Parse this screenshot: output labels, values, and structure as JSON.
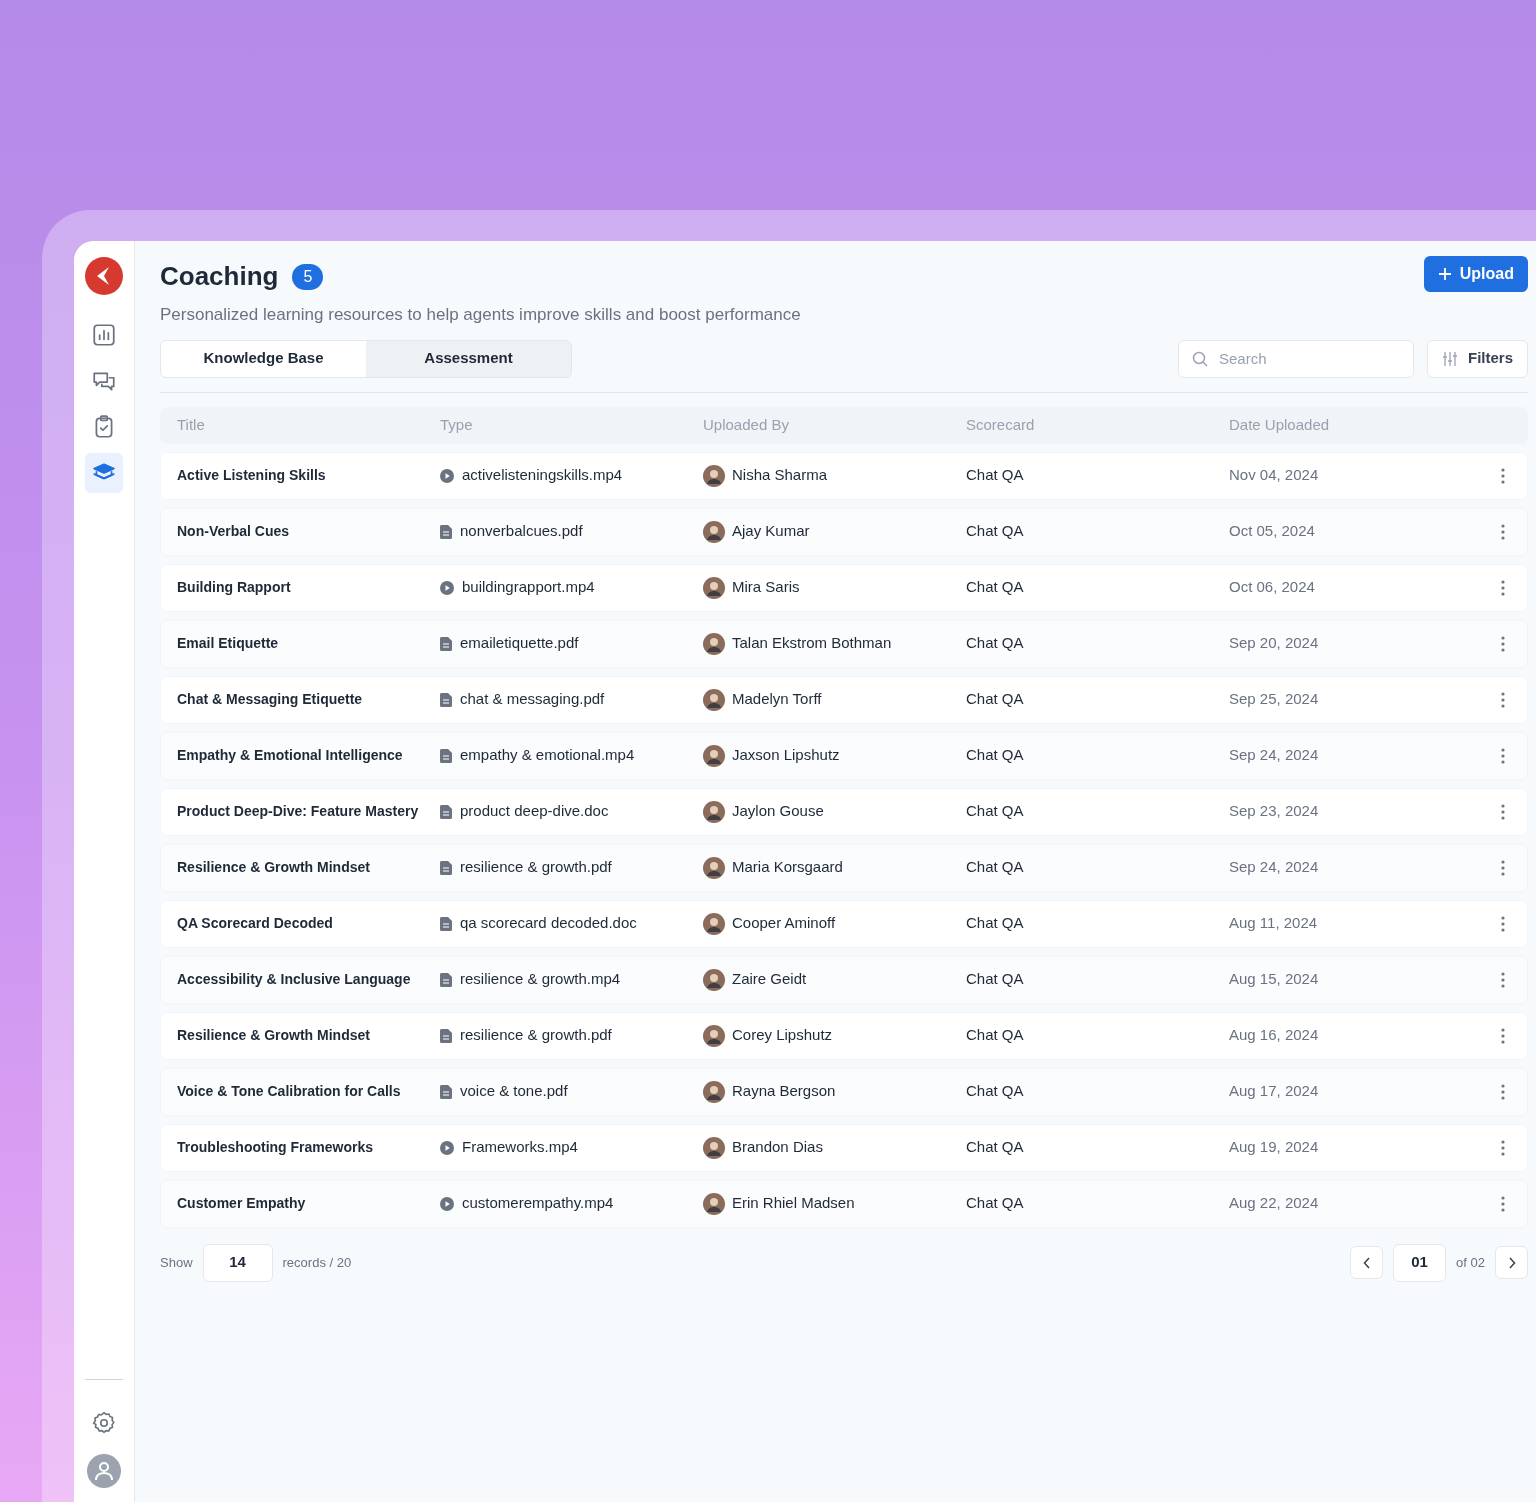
{
  "sidebar": {
    "items": [
      {
        "kind": "chart",
        "selected": false
      },
      {
        "kind": "chat",
        "selected": false
      },
      {
        "kind": "clipboard",
        "selected": false
      },
      {
        "kind": "coaching",
        "selected": true
      }
    ]
  },
  "header": {
    "title": "Coaching",
    "count": "5",
    "subtitle": "Personalized learning resources to help agents improve skills and boost performance",
    "upload_button": "Upload"
  },
  "tabs": [
    {
      "label": "Knowledge Base",
      "selected": true
    },
    {
      "label": "Assessment",
      "selected": false
    }
  ],
  "search": {
    "placeholder": "Search"
  },
  "filters_button": "Filters",
  "table": {
    "columns": [
      "Title",
      "Type",
      "Uploaded By",
      "Scorecard",
      "Date Uploaded"
    ],
    "rows": [
      {
        "title": "Active Listening Skills",
        "kind": "video",
        "file": "activelisteningskills.mp4",
        "uploaded_by": "Nisha Sharma",
        "scorecard": "Chat QA",
        "date": "Nov 04, 2024"
      },
      {
        "title": "Non-Verbal Cues",
        "kind": "doc",
        "file": "nonverbalcues.pdf",
        "uploaded_by": "Ajay Kumar",
        "scorecard": "Chat QA",
        "date": "Oct 05, 2024"
      },
      {
        "title": "Building Rapport",
        "kind": "video",
        "file": "buildingrapport.mp4",
        "uploaded_by": "Mira Saris",
        "scorecard": "Chat QA",
        "date": "Oct 06, 2024"
      },
      {
        "title": "Email Etiquette",
        "kind": "doc",
        "file": "emailetiquette.pdf",
        "uploaded_by": "Talan Ekstrom Bothman",
        "scorecard": "Chat QA",
        "date": "Sep 20, 2024"
      },
      {
        "title": "Chat & Messaging Etiquette",
        "kind": "doc",
        "file": "chat & messaging.pdf",
        "uploaded_by": "Madelyn Torff",
        "scorecard": "Chat QA",
        "date": "Sep 25, 2024"
      },
      {
        "title": "Empathy & Emotional Intelligence",
        "kind": "doc",
        "file": "empathy & emotional.mp4",
        "uploaded_by": "Jaxson Lipshutz",
        "scorecard": "Chat QA",
        "date": "Sep 24, 2024"
      },
      {
        "title": "Product Deep-Dive: Feature Mastery",
        "kind": "doc",
        "file": "product deep-dive.doc",
        "uploaded_by": "Jaylon Gouse",
        "scorecard": "Chat QA",
        "date": "Sep 23, 2024"
      },
      {
        "title": "Resilience & Growth Mindset",
        "kind": "doc",
        "file": "resilience & growth.pdf",
        "uploaded_by": "Maria Korsgaard",
        "scorecard": "Chat QA",
        "date": "Sep 24, 2024"
      },
      {
        "title": "QA Scorecard Decoded",
        "kind": "doc",
        "file": "qa scorecard decoded.doc",
        "uploaded_by": "Cooper Aminoff",
        "scorecard": "Chat QA",
        "date": "Aug 11, 2024"
      },
      {
        "title": "Accessibility & Inclusive Language",
        "kind": "doc",
        "file": "resilience & growth.mp4",
        "uploaded_by": "Zaire Geidt",
        "scorecard": "Chat QA",
        "date": "Aug 15, 2024"
      },
      {
        "title": "Resilience & Growth Mindset",
        "kind": "doc",
        "file": "resilience & growth.pdf",
        "uploaded_by": "Corey Lipshutz",
        "scorecard": "Chat QA",
        "date": "Aug 16, 2024"
      },
      {
        "title": "Voice & Tone Calibration for Calls",
        "kind": "doc",
        "file": "voice & tone.pdf",
        "uploaded_by": "Rayna Bergson",
        "scorecard": "Chat QA",
        "date": "Aug 17, 2024"
      },
      {
        "title": "Troubleshooting Frameworks",
        "kind": "video",
        "file": "Frameworks.mp4",
        "uploaded_by": "Brandon Dias",
        "scorecard": "Chat QA",
        "date": "Aug 19, 2024"
      },
      {
        "title": "Customer Empathy",
        "kind": "video",
        "file": "customerempathy.mp4",
        "uploaded_by": "Erin Rhiel Madsen",
        "scorecard": "Chat QA",
        "date": "Aug 22, 2024"
      }
    ]
  },
  "pagination": {
    "show_label": "Show",
    "per_page": "14",
    "records": "records / 20",
    "page": "01",
    "of": "of 02"
  }
}
